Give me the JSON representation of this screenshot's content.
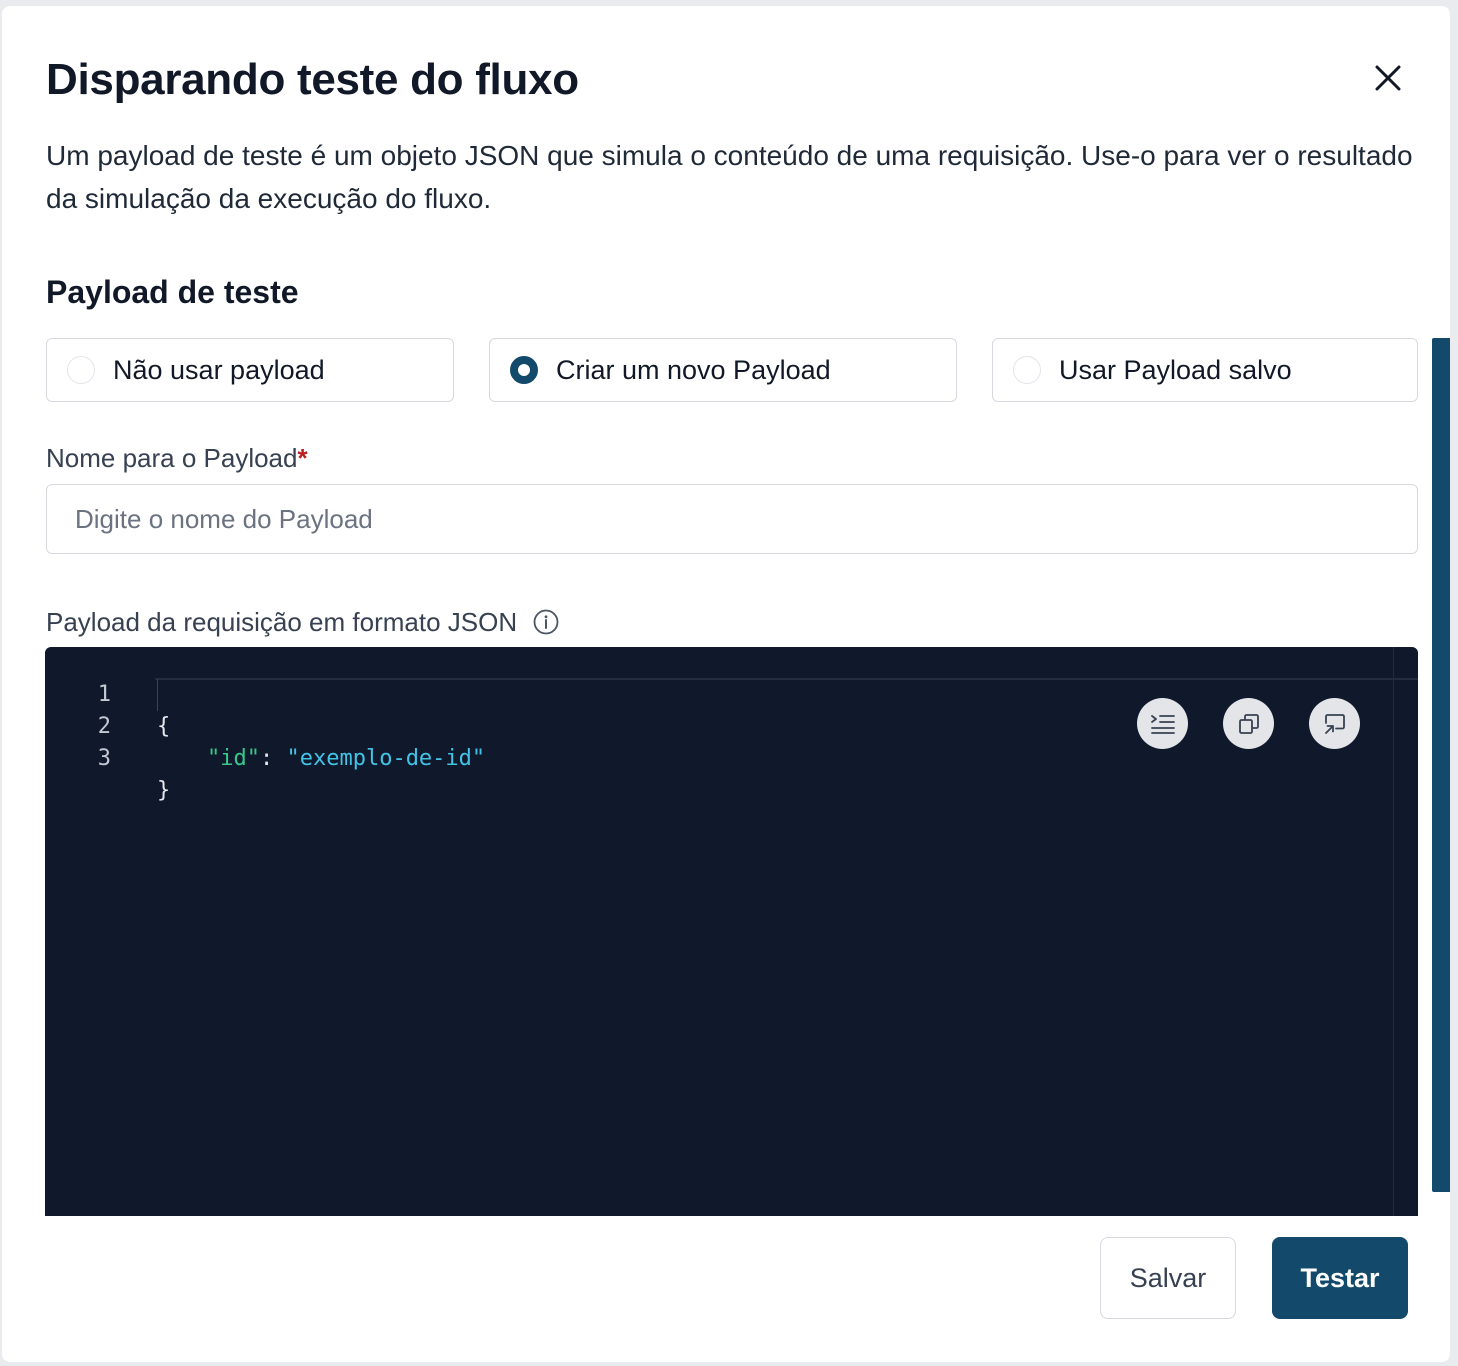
{
  "modal": {
    "title": "Disparando teste do fluxo",
    "description": "Um payload de teste é um objeto JSON que simula o conteúdo de uma requisição. Use-o para ver o resultado da simulação da execução do fluxo.",
    "close_icon": "close-icon"
  },
  "payload_section": {
    "title": "Payload de teste",
    "options": [
      {
        "label": "Não usar payload",
        "selected": false
      },
      {
        "label": "Criar um novo Payload",
        "selected": true
      },
      {
        "label": "Usar Payload salvo",
        "selected": false
      }
    ]
  },
  "name_field": {
    "label": "Nome para o Payload",
    "required_mark": "*",
    "value": "",
    "placeholder": "Digite o nome do Payload"
  },
  "json_field": {
    "label": "Payload da requisição em formato JSON",
    "info_icon": "info-circle-icon"
  },
  "editor": {
    "lines": [
      {
        "number": "1",
        "text": "{"
      },
      {
        "number": "2",
        "key": "\"id\"",
        "colon": ": ",
        "value": "\"exemplo-de-id\""
      },
      {
        "number": "3",
        "text": "}"
      }
    ],
    "toolbar": [
      {
        "icon": "format-indent-icon"
      },
      {
        "icon": "copy-icon"
      },
      {
        "icon": "expand-icon"
      }
    ]
  },
  "colors": {
    "primary": "#134a6c",
    "editor_bg": "#10182b",
    "json_key": "#36c98a",
    "json_value": "#42c3e6",
    "required": "#b91c1c"
  },
  "footer": {
    "save_label": "Salvar",
    "test_label": "Testar"
  }
}
